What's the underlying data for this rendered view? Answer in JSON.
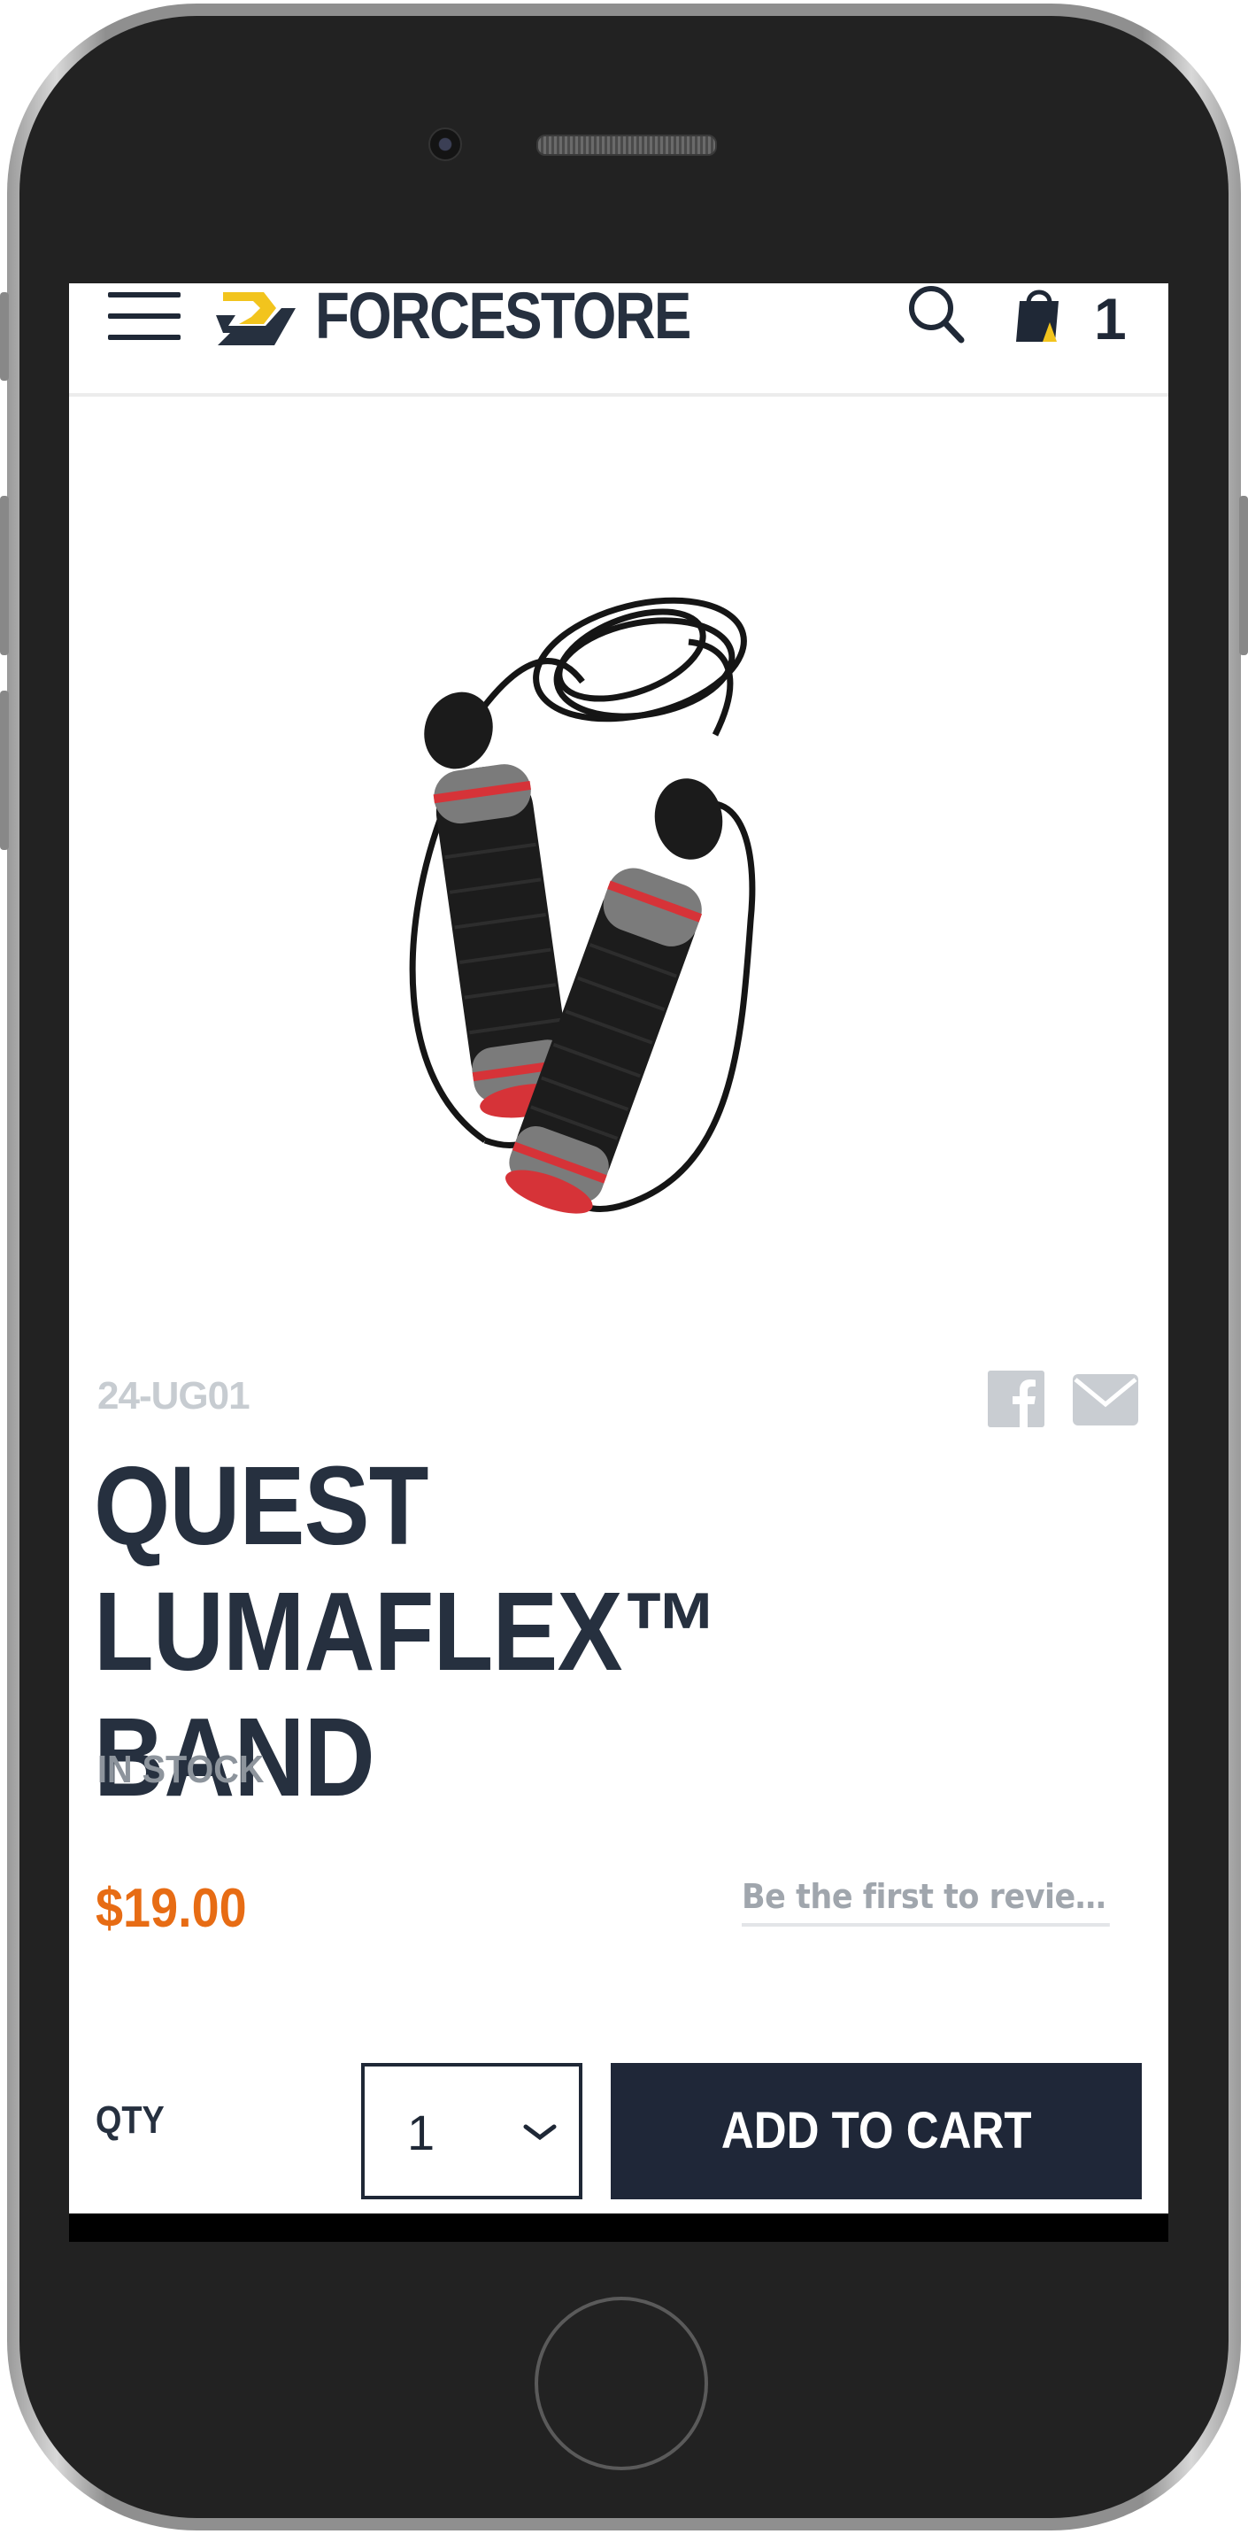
{
  "header": {
    "brand": "FORCESTORE",
    "cart_count": "1"
  },
  "product": {
    "sku": "24-UG01",
    "title_line1": "QUEST LUMAFLEX™",
    "title_line2": "BAND",
    "stock_status": "IN STOCK",
    "price": "$19.00",
    "review_link": "Be the first to review this product"
  },
  "purchase": {
    "qty_label": "QTY",
    "qty_value": "1",
    "add_to_cart_label": "ADD TO CART"
  },
  "colors": {
    "brand_yellow": "#f2c41d",
    "brand_dark": "#26303f",
    "price_orange": "#e76c14",
    "button_dark": "#1f2738",
    "handle_red": "#d63338"
  },
  "icons": {
    "menu": "hamburger-icon",
    "search": "search-icon",
    "cart": "shopping-bag-icon",
    "share_facebook": "facebook-icon",
    "share_email": "envelope-icon",
    "qty_dropdown": "chevron-down-icon"
  }
}
